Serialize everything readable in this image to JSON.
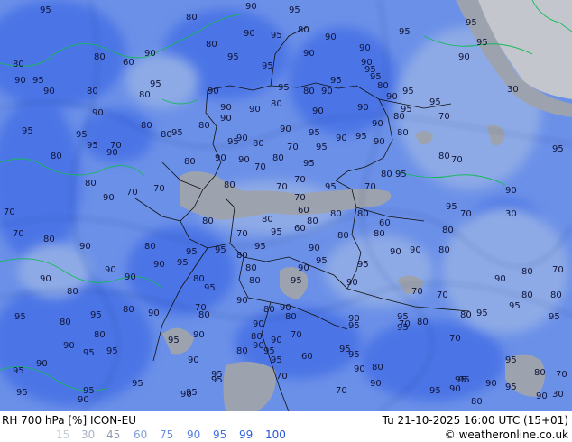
{
  "header": {
    "title": "RH 700 hPa [%] ICON-EU",
    "datetime": "Tu 21-10-2025 16:00 UTC (15+01)",
    "credit_symbol": "©",
    "credit": "weatheronline.co.uk"
  },
  "legend": {
    "values": [
      {
        "label": "15",
        "color": "#c7cdd8"
      },
      {
        "label": "30",
        "color": "#aab3c4"
      },
      {
        "label": "45",
        "color": "#8f9ab0"
      },
      {
        "label": "60",
        "color": "#7f9fd8"
      },
      {
        "label": "75",
        "color": "#6a8fe0"
      },
      {
        "label": "90",
        "color": "#5680e6"
      },
      {
        "label": "95",
        "color": "#3f6fe8"
      },
      {
        "label": "99",
        "color": "#2f5fe0"
      },
      {
        "label": "100",
        "color": "#2452d8"
      }
    ]
  },
  "colors": {
    "humid_high": "#4b74e6",
    "humid_mid": "#6b90e8",
    "humid_low": "#8eaae6",
    "dry": "#9da3ae",
    "very_dry": "#c3c6cc",
    "border": "#101010",
    "coast": "#15b85a",
    "contour": "#1a2a6a"
  },
  "map_labels": [
    "95",
    "80",
    "90",
    "95",
    "95",
    "95",
    "80",
    "90",
    "80",
    "90",
    "95",
    "95",
    "90",
    "80",
    "80",
    "60",
    "90",
    "95",
    "95",
    "90",
    "90",
    "95",
    "90",
    "90",
    "95",
    "90",
    "80",
    "80",
    "95",
    "90",
    "95",
    "80",
    "90",
    "95",
    "95",
    "80",
    "90",
    "95",
    "95",
    "90",
    "90",
    "80",
    "90",
    "90",
    "70",
    "30",
    "90",
    "80",
    "80",
    "90",
    "90",
    "90",
    "95",
    "80",
    "95",
    "90",
    "95",
    "90",
    "80",
    "95",
    "95",
    "95",
    "90",
    "80",
    "95",
    "70",
    "95",
    "90",
    "80",
    "95",
    "80",
    "95",
    "80",
    "70",
    "80",
    "90",
    "90",
    "70",
    "95",
    "70",
    "95",
    "70",
    "95",
    "80",
    "70",
    "80",
    "80",
    "90",
    "70",
    "70",
    "80",
    "30",
    "95",
    "70",
    "90",
    "60",
    "60",
    "70",
    "70",
    "80",
    "90",
    "70",
    "70",
    "80",
    "80",
    "80",
    "70",
    "80",
    "60",
    "80",
    "80",
    "80",
    "90",
    "95",
    "95",
    "80",
    "95",
    "80",
    "95",
    "90",
    "95",
    "90",
    "90",
    "95",
    "95",
    "80",
    "80",
    "90",
    "80",
    "95",
    "90",
    "80",
    "95",
    "95",
    "90",
    "90",
    "90",
    "80",
    "70",
    "80",
    "70",
    "90",
    "80",
    "80",
    "70",
    "80",
    "95",
    "90",
    "80",
    "80",
    "95",
    "70",
    "80",
    "80",
    "70",
    "90",
    "80",
    "80",
    "80",
    "70",
    "95",
    "95",
    "95",
    "90",
    "95",
    "95",
    "70",
    "80",
    "90",
    "95",
    "90",
    "95",
    "90",
    "90",
    "95",
    "95",
    "80",
    "80",
    "95",
    "90",
    "90",
    "95",
    "90",
    "95",
    "80",
    "95",
    "90",
    "95",
    "90",
    "80",
    "70",
    "60",
    "95",
    "90",
    "95",
    "95",
    "70",
    "95",
    "95",
    "95",
    "90",
    "95",
    "95",
    "90",
    "90",
    "95",
    "95",
    "90",
    "90",
    "70",
    "30",
    "80"
  ]
}
